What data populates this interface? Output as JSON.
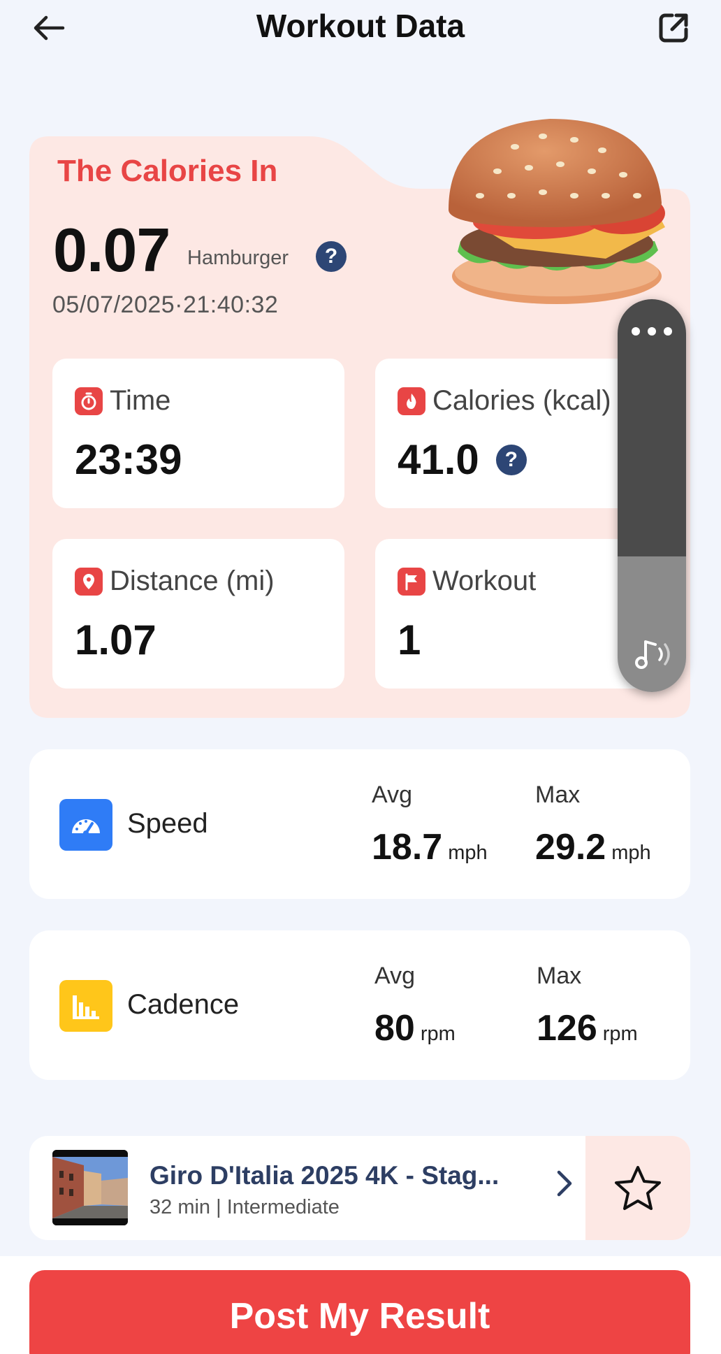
{
  "header": {
    "title": "Workout Data",
    "back_icon": "arrow-left-icon",
    "share_icon": "share-external-icon"
  },
  "calories_in": {
    "title": "The Calories In",
    "value": "0.07",
    "food": "Hamburger",
    "help": "?",
    "datetime": "05/07/2025·21:40:32",
    "image": "hamburger-illustration"
  },
  "stats": {
    "time": {
      "label": "Time",
      "value": "23:39",
      "icon": "stopwatch-icon"
    },
    "calories": {
      "label": "Calories (kcal)",
      "value": "41.0",
      "help": "?",
      "icon": "flame-icon"
    },
    "distance": {
      "label": "Distance (mi)",
      "value": "1.07",
      "icon": "map-pin-icon"
    },
    "workout": {
      "label": "Workout",
      "value": "1",
      "icon": "flag-icon"
    }
  },
  "floating_panel": {
    "more_icon": "more-dots-icon",
    "sound_icon": "music-sound-icon"
  },
  "speed": {
    "name": "Speed",
    "icon": "speedometer-icon",
    "avg_label": "Avg",
    "avg_value": "18.7",
    "avg_unit": "mph",
    "max_label": "Max",
    "max_value": "29.2",
    "max_unit": "mph"
  },
  "cadence": {
    "name": "Cadence",
    "icon": "bar-chart-icon",
    "avg_label": "Avg",
    "avg_value": "80",
    "avg_unit": "rpm",
    "max_label": "Max",
    "max_value": "126",
    "max_unit": "rpm"
  },
  "route": {
    "title": "Giro D'Italia 2025 4K - Stag...",
    "meta": "32 min | Intermediate",
    "chevron_icon": "chevron-right-icon",
    "favorite_icon": "star-outline-icon"
  },
  "footer": {
    "post_label": "Post My Result"
  },
  "colors": {
    "accent_red": "#ee4444",
    "card_pink": "#fde8e4",
    "speed_blue": "#2f7cf6",
    "cadence_yellow": "#ffc61a",
    "navy": "#2d4675"
  }
}
